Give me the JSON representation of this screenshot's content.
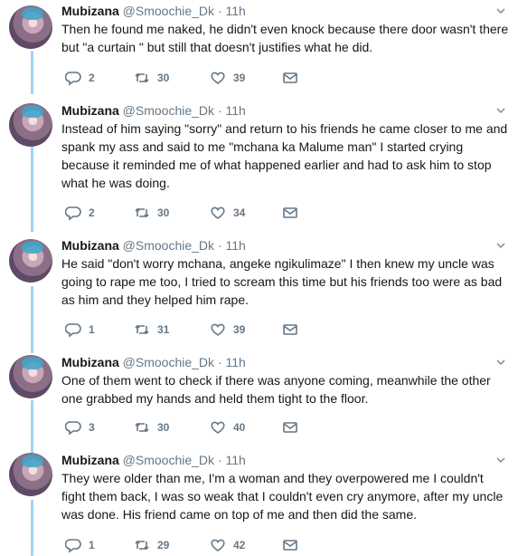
{
  "tweets": [
    {
      "name": "Mubizana",
      "handle": "@Smoochie_Dk",
      "time": "11h",
      "text": "Then he found me naked, he didn't even knock because there door wasn't there but \"a curtain \" but still that doesn't justifies what he did.",
      "replies": "2",
      "retweets": "30",
      "likes": "39"
    },
    {
      "name": "Mubizana",
      "handle": "@Smoochie_Dk",
      "time": "11h",
      "text": "Instead of him saying \"sorry\" and return to his friends he came closer to me and spank my ass and said to me \"mchana ka Malume man\" I started crying because it reminded me of what happened earlier and had to ask him to stop what he was doing.",
      "replies": "2",
      "retweets": "30",
      "likes": "34"
    },
    {
      "name": "Mubizana",
      "handle": "@Smoochie_Dk",
      "time": "11h",
      "text": "He said \"don't worry mchana, angeke ngikulimaze\" I then knew my uncle was going to rape me too, I tried to scream this time but his friends too were as bad as him and they helped him rape.",
      "replies": "1",
      "retweets": "31",
      "likes": "39"
    },
    {
      "name": "Mubizana",
      "handle": "@Smoochie_Dk",
      "time": "11h",
      "text": "One of them went to check if there was anyone coming, meanwhile the other one grabbed my hands and held them tight to the floor.",
      "replies": "3",
      "retweets": "30",
      "likes": "40"
    },
    {
      "name": "Mubizana",
      "handle": "@Smoochie_Dk",
      "time": "11h",
      "text": "They were older than me, I'm a woman and they overpowered me I couldn't fight them back, I was so weak that I couldn't even cry anymore, after my uncle was done. His friend came on top of me and then did the same.",
      "replies": "1",
      "retweets": "29",
      "likes": "42"
    }
  ],
  "separator": "·",
  "icons": {
    "reply": "reply-icon",
    "retweet": "retweet-icon",
    "like": "heart-icon",
    "dm": "envelope-icon",
    "menu": "chevron-down-icon"
  },
  "colors": {
    "thread_line": "#9fd3f5",
    "muted": "#657786",
    "text": "#14171a"
  }
}
